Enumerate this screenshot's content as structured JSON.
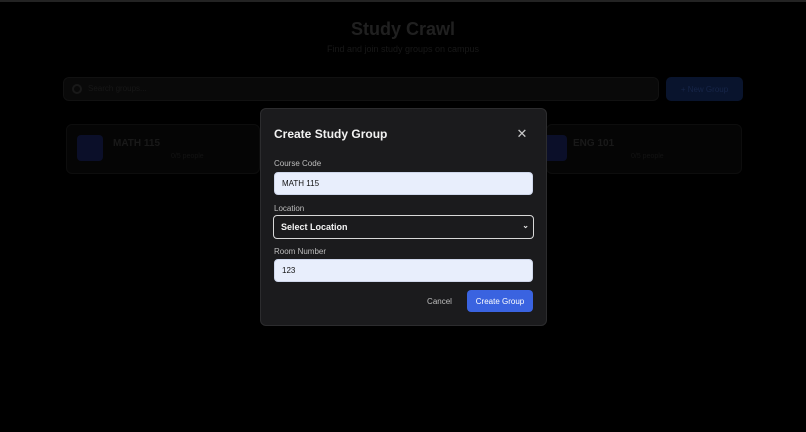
{
  "background": {
    "app_title": "Study Crawl",
    "app_subtitle": "Find and join study groups on campus",
    "search_placeholder": "Search groups...",
    "new_group_label": "+ New Group",
    "cards": [
      {
        "code": "MATH 115",
        "meta": "0/5 people"
      },
      {
        "code": "ENG 101",
        "meta": "0/5 people"
      }
    ]
  },
  "modal": {
    "title": "Create Study Group",
    "close_icon": "close-icon",
    "course_code_label": "Course Code",
    "course_code_value": "MATH 115",
    "location_label": "Location",
    "location_selected": "Select Location",
    "room_number_label": "Room Number",
    "room_number_value": "123",
    "cancel_label": "Cancel",
    "submit_label": "Create Group"
  },
  "colors": {
    "accent": "#3a63e0",
    "modal_bg": "#1b1b1d",
    "input_bg": "#e8eefc"
  }
}
